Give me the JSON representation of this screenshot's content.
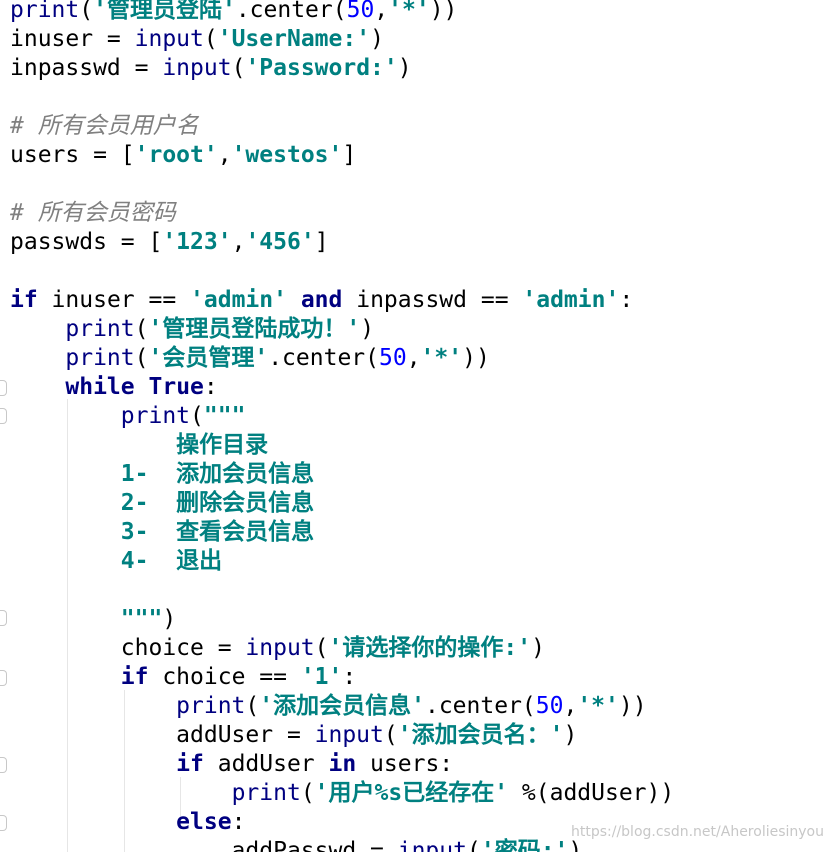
{
  "editor": {
    "colors": {
      "background": "#ffffff",
      "keyword": "#000080",
      "string": "#008080",
      "number": "#0000ff",
      "comment": "#808080",
      "text": "#000000"
    },
    "lines": [
      [
        {
          "t": "print",
          "c": "builtin"
        },
        {
          "t": "(",
          "c": "plain"
        },
        {
          "t": "'管理员登陆'",
          "c": "str"
        },
        {
          "t": ".center(",
          "c": "plain"
        },
        {
          "t": "50",
          "c": "num"
        },
        {
          "t": ",",
          "c": "plain"
        },
        {
          "t": "'*'",
          "c": "str"
        },
        {
          "t": "))",
          "c": "plain"
        }
      ],
      [
        {
          "t": "inuser = ",
          "c": "plain"
        },
        {
          "t": "input",
          "c": "builtin"
        },
        {
          "t": "(",
          "c": "plain"
        },
        {
          "t": "'UserName:'",
          "c": "str"
        },
        {
          "t": ")",
          "c": "plain"
        }
      ],
      [
        {
          "t": "inpasswd = ",
          "c": "plain"
        },
        {
          "t": "input",
          "c": "builtin"
        },
        {
          "t": "(",
          "c": "plain"
        },
        {
          "t": "'Password:'",
          "c": "str"
        },
        {
          "t": ")",
          "c": "plain"
        }
      ],
      [],
      [
        {
          "t": "# 所有会员用户名",
          "c": "comment"
        }
      ],
      [
        {
          "t": "users = [",
          "c": "plain"
        },
        {
          "t": "'root'",
          "c": "str"
        },
        {
          "t": ",",
          "c": "plain"
        },
        {
          "t": "'westos'",
          "c": "str"
        },
        {
          "t": "]",
          "c": "plain"
        }
      ],
      [],
      [
        {
          "t": "# 所有会员密码",
          "c": "comment"
        }
      ],
      [
        {
          "t": "passwds = [",
          "c": "plain"
        },
        {
          "t": "'123'",
          "c": "str"
        },
        {
          "t": ",",
          "c": "plain"
        },
        {
          "t": "'456'",
          "c": "str"
        },
        {
          "t": "]",
          "c": "plain"
        }
      ],
      [],
      [
        {
          "t": "if",
          "c": "kw"
        },
        {
          "t": " inuser == ",
          "c": "plain"
        },
        {
          "t": "'admin'",
          "c": "str"
        },
        {
          "t": " ",
          "c": "plain"
        },
        {
          "t": "and",
          "c": "kw"
        },
        {
          "t": " inpasswd == ",
          "c": "plain"
        },
        {
          "t": "'admin'",
          "c": "str"
        },
        {
          "t": ":",
          "c": "plain"
        }
      ],
      [
        {
          "t": "    ",
          "c": "plain"
        },
        {
          "t": "print",
          "c": "builtin"
        },
        {
          "t": "(",
          "c": "plain"
        },
        {
          "t": "'管理员登陆成功！'",
          "c": "str"
        },
        {
          "t": ")",
          "c": "plain"
        }
      ],
      [
        {
          "t": "    ",
          "c": "plain"
        },
        {
          "t": "print",
          "c": "builtin"
        },
        {
          "t": "(",
          "c": "plain"
        },
        {
          "t": "'会员管理'",
          "c": "str"
        },
        {
          "t": ".center(",
          "c": "plain"
        },
        {
          "t": "50",
          "c": "num"
        },
        {
          "t": ",",
          "c": "plain"
        },
        {
          "t": "'*'",
          "c": "str"
        },
        {
          "t": "))",
          "c": "plain"
        }
      ],
      [
        {
          "t": "    ",
          "c": "plain"
        },
        {
          "t": "while",
          "c": "kw"
        },
        {
          "t": " ",
          "c": "plain"
        },
        {
          "t": "True",
          "c": "kw"
        },
        {
          "t": ":",
          "c": "plain"
        }
      ],
      [
        {
          "t": "        ",
          "c": "plain"
        },
        {
          "t": "print",
          "c": "builtin"
        },
        {
          "t": "(",
          "c": "plain"
        },
        {
          "t": "\"\"\"",
          "c": "str"
        }
      ],
      [
        {
          "t": "            操作目录",
          "c": "str"
        }
      ],
      [
        {
          "t": "        1-  添加会员信息",
          "c": "str"
        }
      ],
      [
        {
          "t": "        2-  删除会员信息",
          "c": "str"
        }
      ],
      [
        {
          "t": "        3-  查看会员信息",
          "c": "str"
        }
      ],
      [
        {
          "t": "        4-  退出",
          "c": "str"
        }
      ],
      [],
      [
        {
          "t": "        ",
          "c": "plain"
        },
        {
          "t": "\"\"\"",
          "c": "str"
        },
        {
          "t": ")",
          "c": "plain"
        }
      ],
      [
        {
          "t": "        choice = ",
          "c": "plain"
        },
        {
          "t": "input",
          "c": "builtin"
        },
        {
          "t": "(",
          "c": "plain"
        },
        {
          "t": "'请选择你的操作:'",
          "c": "str"
        },
        {
          "t": ")",
          "c": "plain"
        }
      ],
      [
        {
          "t": "        ",
          "c": "plain"
        },
        {
          "t": "if",
          "c": "kw"
        },
        {
          "t": " choice == ",
          "c": "plain"
        },
        {
          "t": "'1'",
          "c": "str"
        },
        {
          "t": ":",
          "c": "plain"
        }
      ],
      [
        {
          "t": "            ",
          "c": "plain"
        },
        {
          "t": "print",
          "c": "builtin"
        },
        {
          "t": "(",
          "c": "plain"
        },
        {
          "t": "'添加会员信息'",
          "c": "str"
        },
        {
          "t": ".center(",
          "c": "plain"
        },
        {
          "t": "50",
          "c": "num"
        },
        {
          "t": ",",
          "c": "plain"
        },
        {
          "t": "'*'",
          "c": "str"
        },
        {
          "t": "))",
          "c": "plain"
        }
      ],
      [
        {
          "t": "            addUser = ",
          "c": "plain"
        },
        {
          "t": "input",
          "c": "builtin"
        },
        {
          "t": "(",
          "c": "plain"
        },
        {
          "t": "'添加会员名：'",
          "c": "str"
        },
        {
          "t": ")",
          "c": "plain"
        }
      ],
      [
        {
          "t": "            ",
          "c": "plain"
        },
        {
          "t": "if",
          "c": "kw"
        },
        {
          "t": " addUser ",
          "c": "plain"
        },
        {
          "t": "in",
          "c": "kw"
        },
        {
          "t": " users:",
          "c": "plain"
        }
      ],
      [
        {
          "t": "                ",
          "c": "plain"
        },
        {
          "t": "print",
          "c": "builtin"
        },
        {
          "t": "(",
          "c": "plain"
        },
        {
          "t": "'用户%s已经存在'",
          "c": "str"
        },
        {
          "t": " %(addUser))",
          "c": "plain"
        }
      ],
      [
        {
          "t": "            ",
          "c": "plain"
        },
        {
          "t": "else",
          "c": "kw"
        },
        {
          "t": ":",
          "c": "plain"
        }
      ],
      [
        {
          "t": "                addPasswd = ",
          "c": "plain"
        },
        {
          "t": "input",
          "c": "builtin"
        },
        {
          "t": "(",
          "c": "plain"
        },
        {
          "t": "'密码:'",
          "c": "str"
        },
        {
          "t": ")",
          "c": "plain"
        }
      ]
    ]
  },
  "watermark": "https://blog.csdn.net/Aheroliesinyou"
}
